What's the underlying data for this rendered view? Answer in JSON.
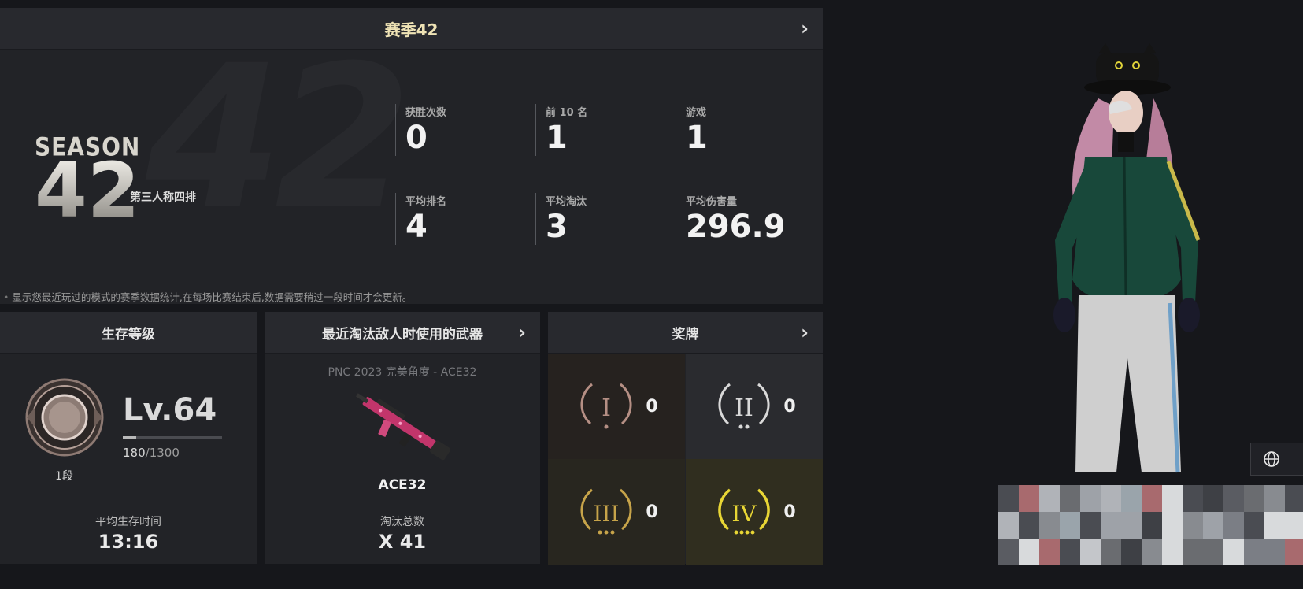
{
  "season": {
    "title": "赛季42",
    "logo_word": "SEASON",
    "logo_number": "42",
    "bg_number": "42",
    "mode": "第三人称四排",
    "stats": [
      {
        "label": "获胜次数",
        "value": "0"
      },
      {
        "label": "前 10 名",
        "value": "1"
      },
      {
        "label": "游戏",
        "value": "1"
      },
      {
        "label": "平均排名",
        "value": "4"
      },
      {
        "label": "平均淘汰",
        "value": "3"
      },
      {
        "label": "平均伤害量",
        "value": "296.9"
      }
    ],
    "note": "显示您最近玩过的模式的赛季数据统计,在每场比赛结束后,数据需要稍过一段时间才会更新。"
  },
  "survival": {
    "title": "生存等级",
    "tier": "1段",
    "level": "Lv.64",
    "xp_current": "180",
    "xp_total": "/1300",
    "xp_fraction": 0.138,
    "avg_time_label": "平均生存时间",
    "avg_time_value": "13:16"
  },
  "weapon": {
    "title": "最近淘汰敌人时使用的武器",
    "skin": "PNC 2023 完美角度 - ACE32",
    "name": "ACE32",
    "kills_label": "淘汰总数",
    "kills_value": "X 41"
  },
  "medals": {
    "title": "奖牌",
    "items": [
      {
        "numeral": "I",
        "count": "0",
        "color": "#b58f84"
      },
      {
        "numeral": "II",
        "count": "0",
        "color": "#d9d9d9"
      },
      {
        "numeral": "III",
        "count": "0",
        "color": "#c7a44a"
      },
      {
        "numeral": "IV",
        "count": "0",
        "color": "#e8d635"
      }
    ]
  },
  "icons": {
    "chevron": "chevron-right-icon",
    "globe": "globe-icon",
    "edit": "edit-icon"
  }
}
